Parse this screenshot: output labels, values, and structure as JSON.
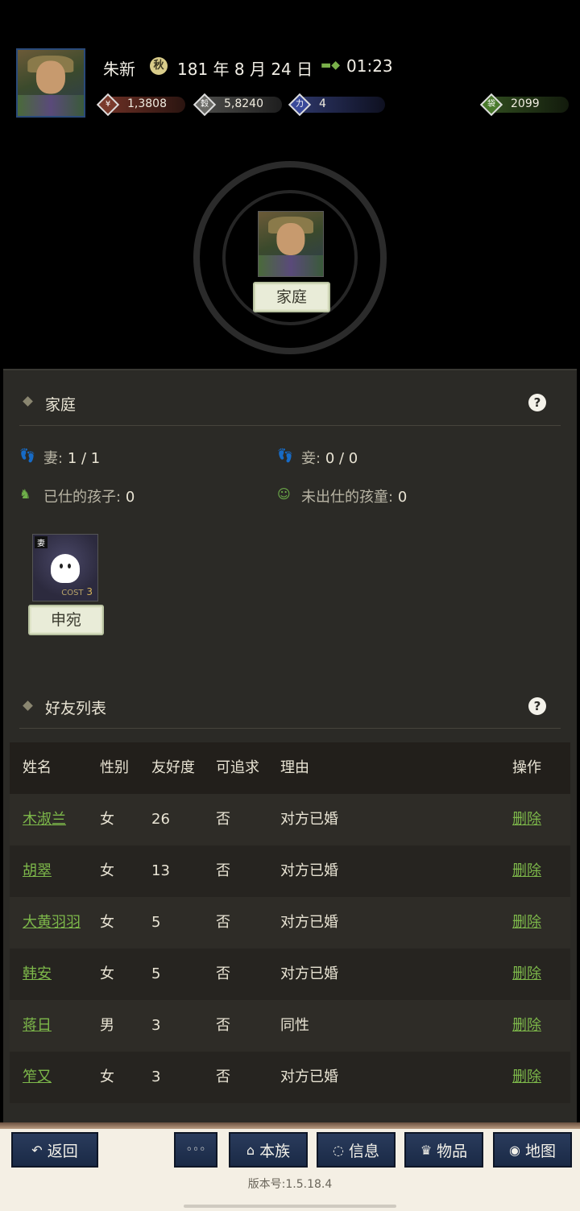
{
  "header": {
    "player_name": "朱新",
    "date": "181 年 8 月 24 日",
    "date_icon": "秋",
    "time": "01:23",
    "resources": [
      {
        "name": "money",
        "icon": "money-icon",
        "glyph": "¥",
        "value": "1,3808",
        "color": "#6a2f24"
      },
      {
        "name": "grain",
        "icon": "grain-icon",
        "glyph": "穀",
        "value": "5,8240",
        "color": "#4a4a48"
      },
      {
        "name": "strength",
        "icon": "strength-icon",
        "glyph": "力",
        "value": "4",
        "color": "#2c3566"
      },
      {
        "name": "jade",
        "icon": "jade-bag-icon",
        "glyph": "袋",
        "value": "2099",
        "color": "#2f4a1e"
      }
    ]
  },
  "center": {
    "family_label": "家庭"
  },
  "family": {
    "title": "家庭",
    "help": "?",
    "wife_label": "妻:",
    "wife_value": "1 / 1",
    "concubine_label": "妾:",
    "concubine_value": "0 / 0",
    "employed_children_label": "已仕的孩子:",
    "employed_children_value": "0",
    "unemployed_children_label": "未出仕的孩童:",
    "unemployed_children_value": "0",
    "spouse": {
      "tag": "妻",
      "cost_text": "COST",
      "cost_value": "3",
      "name": "申宛"
    }
  },
  "friends": {
    "title": "好友列表",
    "help": "?",
    "columns": [
      "姓名",
      "性别",
      "友好度",
      "可追求",
      "理由",
      "操作"
    ],
    "rows": [
      {
        "name": "木淑兰",
        "sex": "女",
        "favor": "26",
        "pursue": "否",
        "reason": "对方已婚",
        "action": "删除"
      },
      {
        "name": "胡翠",
        "sex": "女",
        "favor": "13",
        "pursue": "否",
        "reason": "对方已婚",
        "action": "删除"
      },
      {
        "name": "大黄羽羽",
        "sex": "女",
        "favor": "5",
        "pursue": "否",
        "reason": "对方已婚",
        "action": "删除"
      },
      {
        "name": "韩安",
        "sex": "女",
        "favor": "5",
        "pursue": "否",
        "reason": "对方已婚",
        "action": "删除"
      },
      {
        "name": "蒋日",
        "sex": "男",
        "favor": "3",
        "pursue": "否",
        "reason": "同性",
        "action": "删除"
      },
      {
        "name": "笮又",
        "sex": "女",
        "favor": "3",
        "pursue": "否",
        "reason": "对方已婚",
        "action": "删除"
      }
    ]
  },
  "bottom_bar": {
    "back": "返回",
    "more": "◦◦◦",
    "clan": "本族",
    "info": "信息",
    "items": "物品",
    "map": "地图",
    "version": "版本号:1.5.18.4"
  }
}
